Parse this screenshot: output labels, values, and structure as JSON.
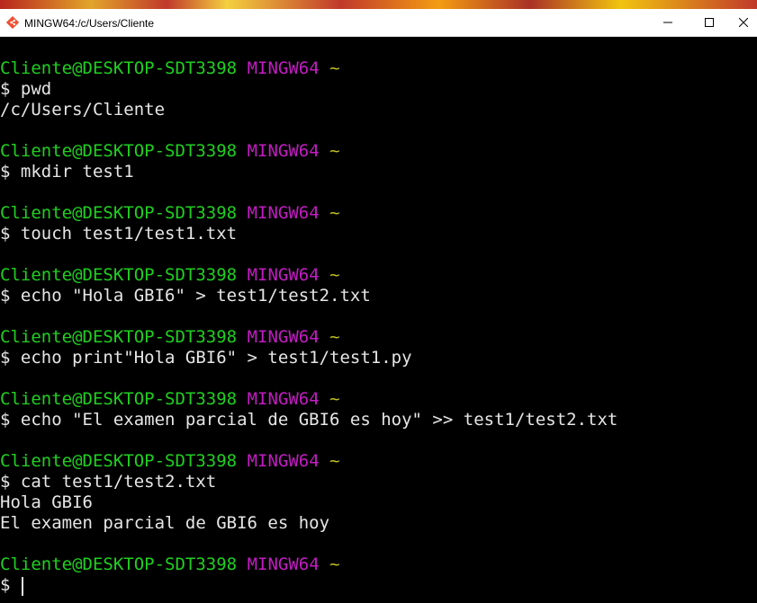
{
  "window": {
    "title": "MINGW64:/c/Users/Cliente",
    "icon": "git-bash-icon",
    "controls": [
      "minimize-icon",
      "maximize-icon",
      "close-icon"
    ]
  },
  "colors": {
    "prompt_user": "#1fd11f",
    "prompt_shell": "#c31cc3",
    "prompt_path": "#c0c020",
    "text": "#e6e6e6",
    "background": "#000000"
  },
  "terminal": {
    "prompt": {
      "user_host": "Cliente@DESKTOP-SDT3398",
      "shell": "MINGW64",
      "path": "~"
    },
    "sessions": [
      {
        "command": "$ pwd",
        "output": [
          "/c/Users/Cliente"
        ]
      },
      {
        "command": "$ mkdir test1",
        "output": []
      },
      {
        "command": "$ touch test1/test1.txt",
        "output": []
      },
      {
        "command": "$ echo \"Hola GBI6\" > test1/test2.txt",
        "output": []
      },
      {
        "command": "$ echo print\"Hola GBI6\" > test1/test1.py",
        "output": []
      },
      {
        "command": "$ echo \"El examen parcial de GBI6 es hoy\" >> test1/test2.txt",
        "output": []
      },
      {
        "command": "$ cat test1/test2.txt",
        "output": [
          "Hola GBI6",
          "El examen parcial de GBI6 es hoy"
        ]
      }
    ],
    "final_prompt": "$ "
  }
}
